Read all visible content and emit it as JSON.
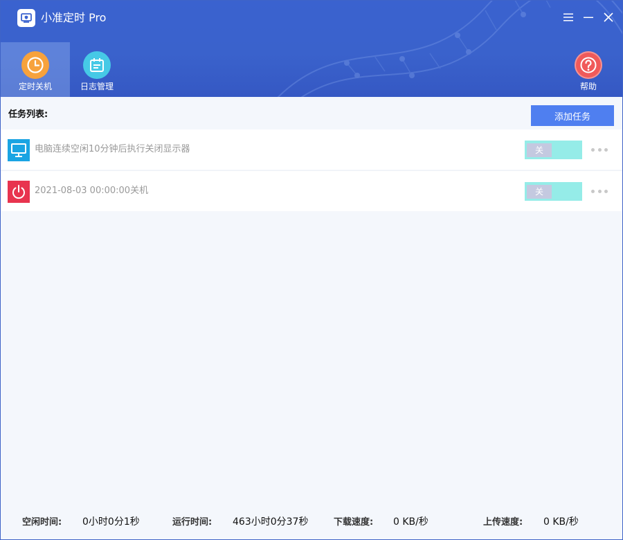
{
  "app": {
    "title": "小准定时 Pro",
    "colors": {
      "header": "#3a62cf",
      "accent_button": "#4f7ff0",
      "toggle_bg": "#95ece8",
      "monitor_icon": "#1aa4e3",
      "power_icon": "#e8344f"
    }
  },
  "window_controls": {
    "menu_icon": "hamburger-icon",
    "minimize_icon": "minimize-icon",
    "close_icon": "close-icon"
  },
  "nav": {
    "tabs": [
      {
        "label": "定时关机",
        "icon": "clock-icon",
        "active": true
      },
      {
        "label": "日志管理",
        "icon": "calendar-log-icon",
        "active": false
      }
    ],
    "help": {
      "label": "帮助",
      "icon": "help-icon"
    }
  },
  "tasks": {
    "header_label": "任务列表:",
    "add_button_label": "添加任务",
    "items": [
      {
        "icon": "monitor-icon",
        "text": "电脑连续空闲10分钟后执行关闭显示器",
        "toggle_label": "关",
        "enabled": false
      },
      {
        "icon": "power-icon",
        "text": "2021-08-03 00:00:00关机",
        "toggle_label": "关",
        "enabled": false
      }
    ]
  },
  "status": {
    "idle_label": "空闲时间:",
    "idle_value": "0小时0分1秒",
    "run_label": "运行时间:",
    "run_value": "463小时0分37秒",
    "download_label": "下载速度:",
    "download_value": "0 KB/秒",
    "upload_label": "上传速度:",
    "upload_value": "0 KB/秒"
  }
}
